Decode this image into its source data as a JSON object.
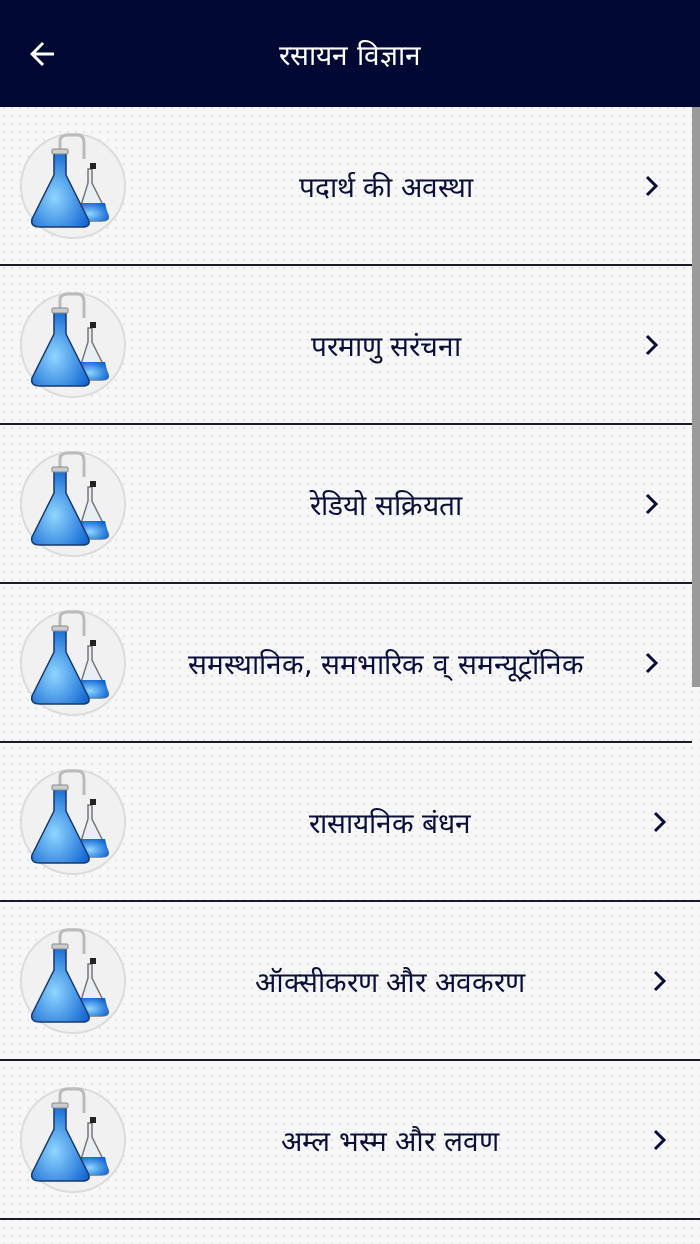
{
  "app_bar": {
    "title": "रसायन विज्ञान"
  },
  "topics": [
    {
      "label": "पदार्थ की अवस्था"
    },
    {
      "label": "परमाणु सरंचना"
    },
    {
      "label": "रेडियो सक्रियता"
    },
    {
      "label": "समस्थानिक, समभारिक व् समन्यूट्रॉनिक"
    },
    {
      "label": "रासायनिक बंधन"
    },
    {
      "label": "ऑक्सीकरण और अवकरण"
    },
    {
      "label": "अम्ल भस्म और लवण"
    }
  ]
}
